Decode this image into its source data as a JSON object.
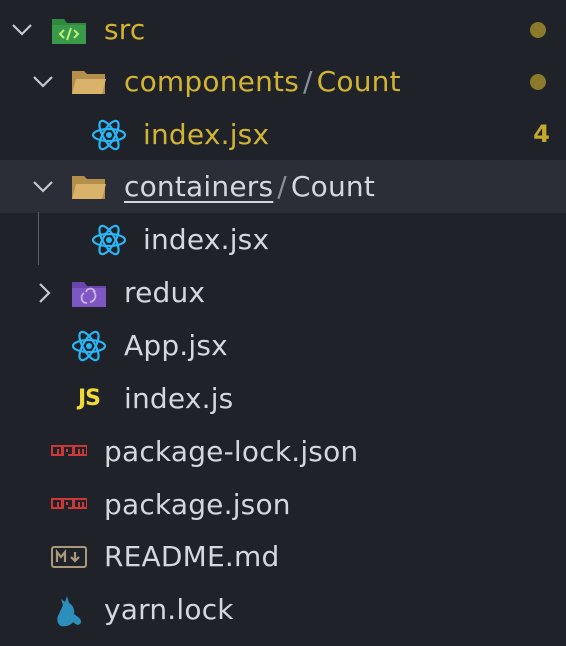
{
  "colors": {
    "background": "#1f2229",
    "selected_row": "#2b2e36",
    "modified_text": "#d2b433",
    "react_icon": "#29b6f6",
    "folder_icon": "#d9b36a",
    "src_folder": "#3a9a4a",
    "redux_folder": "#7e57c2",
    "npm_icon": "#cb3837",
    "js_icon": "#f0d93a",
    "yarn_icon": "#2c8ebb"
  },
  "tree": {
    "src": {
      "label": "src",
      "icon": "src-folder-icon",
      "expanded": true,
      "modified": true
    },
    "components": {
      "label": "components",
      "separator": "/",
      "sub": "Count",
      "icon": "folder-open-icon",
      "expanded": true,
      "modified": true
    },
    "components_index": {
      "label": "index.jsx",
      "icon": "react-icon",
      "badge": "4"
    },
    "containers": {
      "label": "containers",
      "separator": "/",
      "sub": "Count",
      "icon": "folder-open-icon",
      "expanded": true
    },
    "containers_index": {
      "label": "index.jsx",
      "icon": "react-icon"
    },
    "redux": {
      "label": "redux",
      "icon": "redux-folder-icon",
      "expanded": false
    },
    "app": {
      "label": "App.jsx",
      "icon": "react-icon"
    },
    "index_js": {
      "label": "index.js",
      "icon": "js-icon",
      "icon_text": "JS"
    },
    "package_lock": {
      "label": "package-lock.json",
      "icon": "npm-icon"
    },
    "package": {
      "label": "package.json",
      "icon": "npm-icon"
    },
    "readme": {
      "label": "README.md",
      "icon": "markdown-icon"
    },
    "yarn": {
      "label": "yarn.lock",
      "icon": "yarn-icon"
    }
  }
}
